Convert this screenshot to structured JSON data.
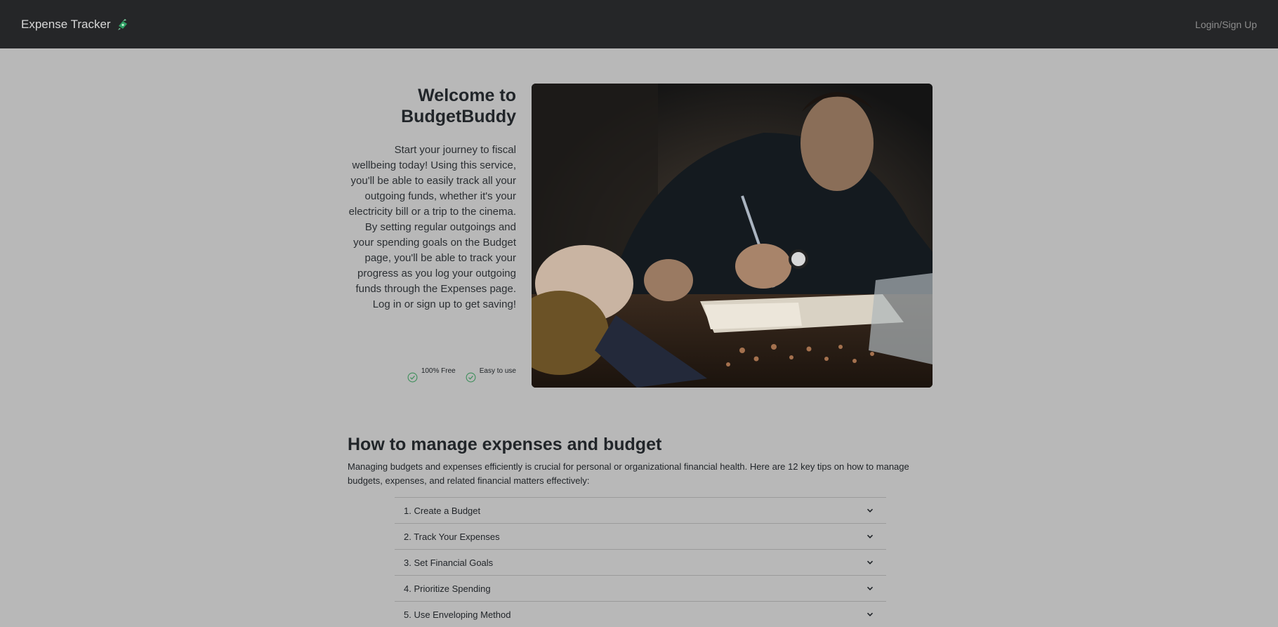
{
  "navbar": {
    "brand": "Expense Tracker",
    "login_link": "Login/Sign Up"
  },
  "hero": {
    "title": "Welcome to BudgetBuddy",
    "description": "Start your journey to fiscal wellbeing today! Using this service, you'll be able to easily track all your outgoing funds, whether it's your electricity bill or a trip to the cinema. By setting regular outgoings and your spending goals on the Budget page, you'll be able to track your progress as you log your outgoing funds through the Expenses page. Log in or sign up to get saving!",
    "features": [
      {
        "label": "100% Free",
        "icon": "check-circle-icon"
      },
      {
        "label": "Easy to use",
        "icon": "check-circle-icon"
      }
    ]
  },
  "section": {
    "title": "How to manage expenses and budget",
    "description": "Managing budgets and expenses efficiently is crucial for personal or organizational financial health. Here are 12 key tips on how to manage budgets, expenses, and related financial matters effectively:"
  },
  "accordion": [
    {
      "label": "1. Create a Budget"
    },
    {
      "label": "2. Track Your Expenses"
    },
    {
      "label": "3. Set Financial Goals"
    },
    {
      "label": "4. Prioritize Spending"
    },
    {
      "label": "5. Use Enveloping Method"
    }
  ],
  "colors": {
    "navbar": "#252628",
    "background": "#b8b8b8",
    "check": "#3f8f5c"
  }
}
